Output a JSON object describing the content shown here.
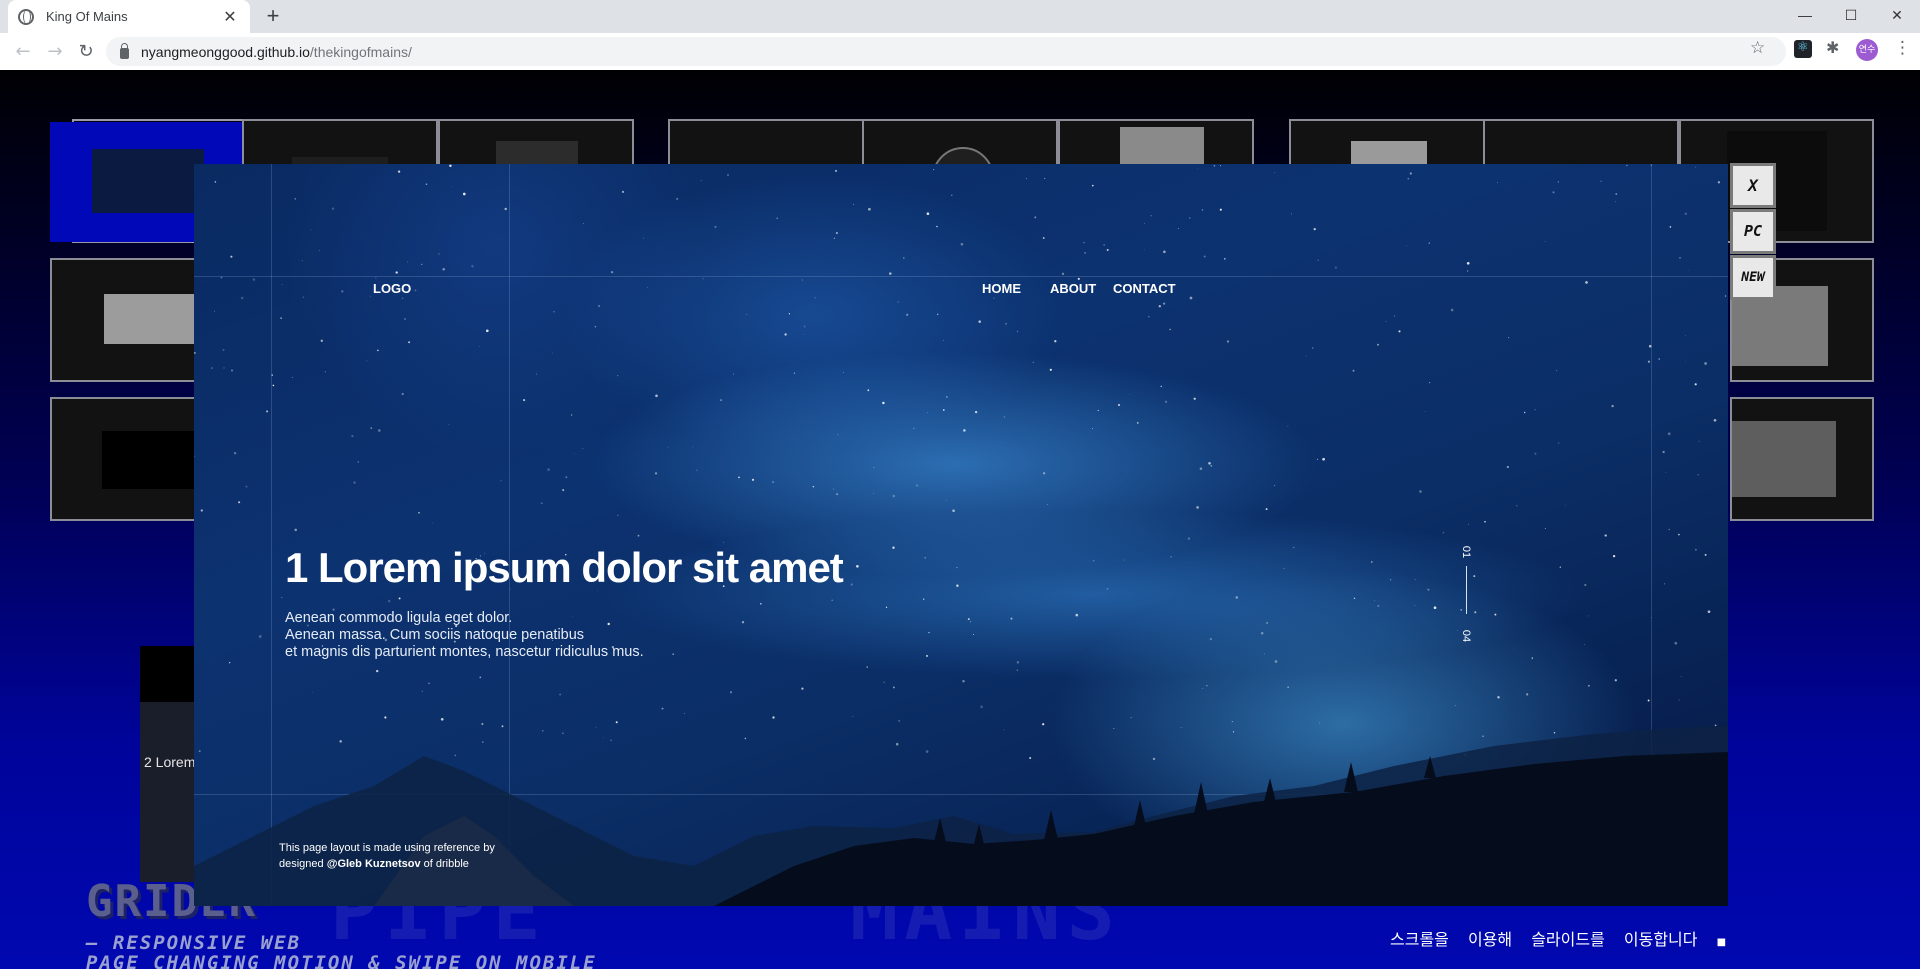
{
  "browser": {
    "tab_title": "King Of Mains",
    "new_tab": "+",
    "url_host": "nyangmeonggood.github.io",
    "url_path": "/thekingofmains/",
    "profile_initials": "연수"
  },
  "hero": {
    "logo": "LOGO",
    "nav": [
      "HOME",
      "ABOUT",
      "CONTACT"
    ],
    "headline": "1 Lorem ipsum dolor sit amet",
    "desc_lines": [
      "Aenean commodo ligula eget dolor.",
      "Aenean massa. Cum sociis natoque penatibus",
      "et magnis dis parturient montes, nascetur ridiculus mus."
    ],
    "credit_line1": "This page layout is made using reference by",
    "credit_prefix": "designed ",
    "credit_author": "@Gleb Kuznetsov",
    "credit_suffix": " of dribble",
    "pager_current": "01",
    "pager_total": "04"
  },
  "side_buttons": {
    "close": "X",
    "pc": "PC",
    "new": "NEW"
  },
  "peek_card": {
    "title": "2 Lorem"
  },
  "background": {
    "title": "GRIDER",
    "ghost_1": "PIPE",
    "ghost_2": "MAINS",
    "sub_1": "— RESPONSIVE WEB",
    "sub_2": "PAGE CHANGING MOTION & SWIPE ON MOBILE",
    "hint": "스크롤을 이용해 슬라이드를 이동합니다"
  },
  "colors": {
    "accent_blue": "#0008b8",
    "hero_deep": "#0b2e66",
    "nebula": "#46a0eb"
  }
}
